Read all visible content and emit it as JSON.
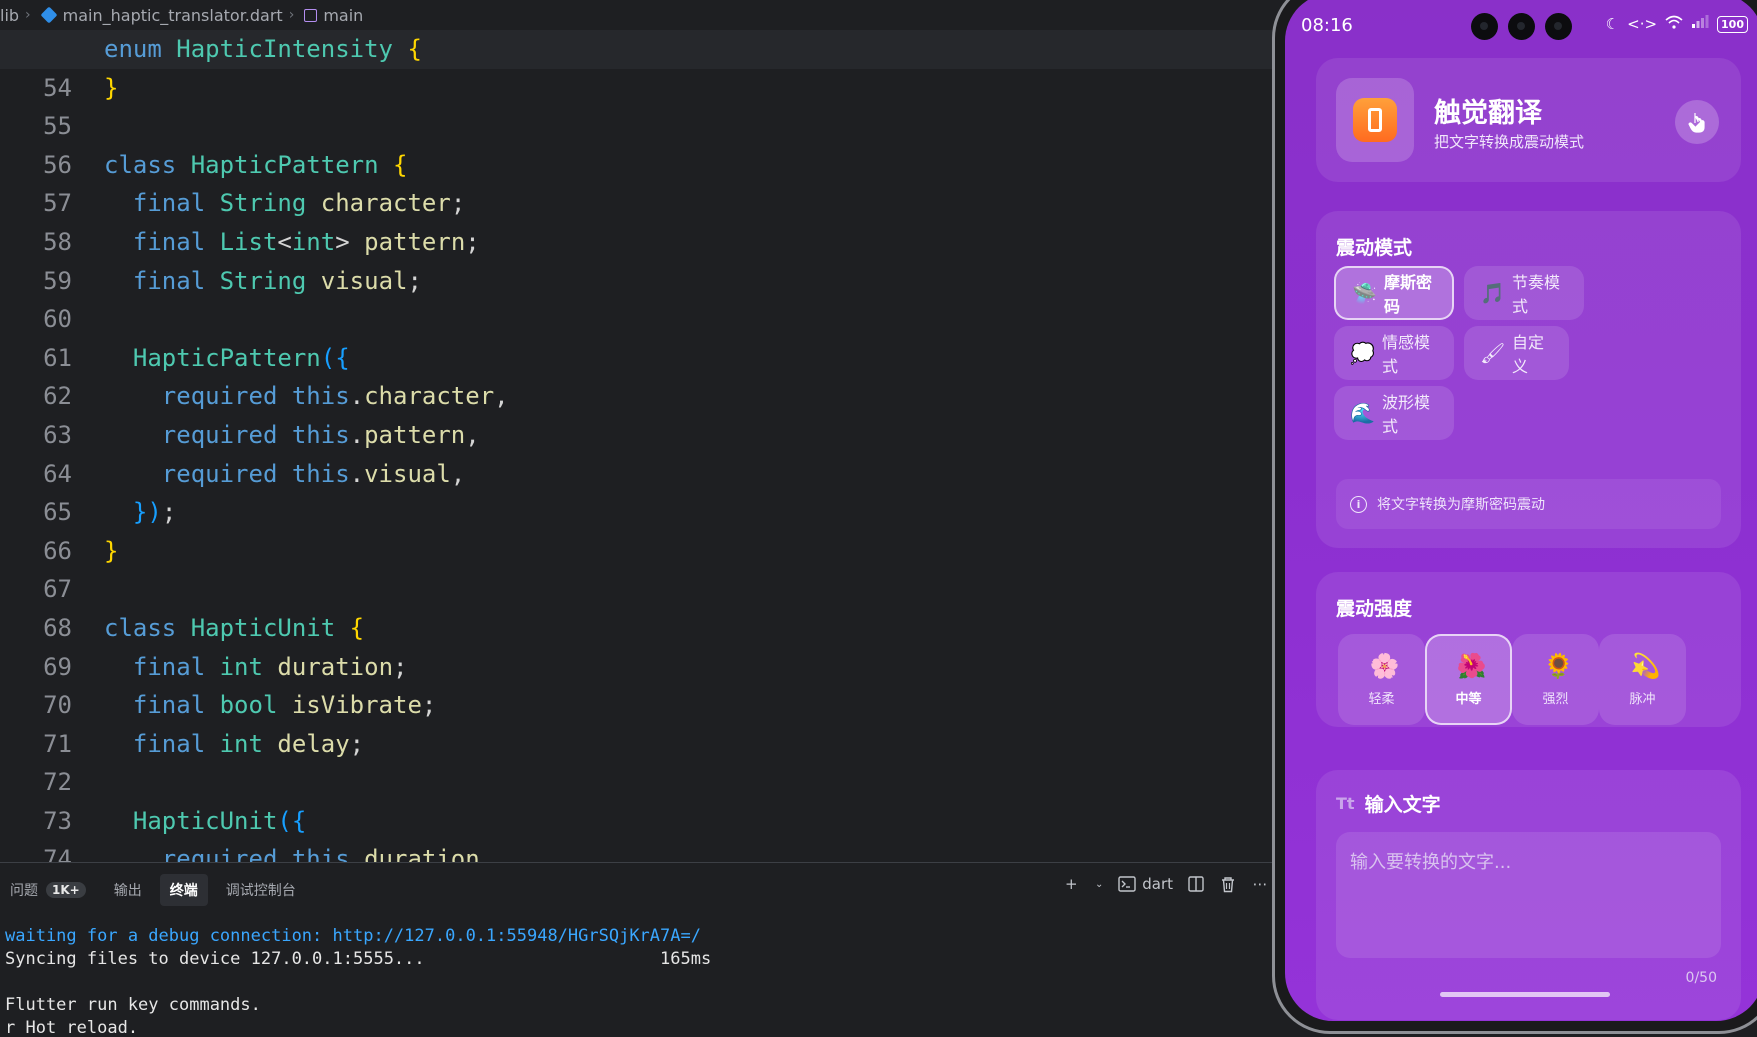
{
  "breadcrumb": {
    "root": "lib",
    "file": "main_haptic_translator.dart",
    "symbol": "main"
  },
  "panel": {
    "tabs": [
      {
        "label": "问题",
        "badge": "1K+"
      },
      {
        "label": "输出"
      },
      {
        "label": "终端"
      },
      {
        "label": "调试控制台"
      }
    ],
    "shell_label": "dart",
    "terminal_lines": [
      "waiting for a debug connection: http://127.0.0.1:55948/HGrSQjKrA7A=/",
      "Syncing files to device 127.0.0.1:5555...                       165ms",
      "",
      "Flutter run key commands.",
      "r Hot reload."
    ]
  },
  "phone": {
    "status": {
      "time": "08:16",
      "battery": "100"
    },
    "app": {
      "title": "触觉翻译",
      "subtitle": "把文字转换成震动模式"
    },
    "mode": {
      "title": "震动模式",
      "options": [
        {
          "label": "摩斯密码",
          "icon": "🛸",
          "icon_name": "ufo-icon"
        },
        {
          "label": "节奏模式",
          "icon": "🎵",
          "icon_name": "music-note-icon"
        },
        {
          "label": "情感模式",
          "icon": "💭",
          "icon_name": "thought-bubble-icon"
        },
        {
          "label": "自定义",
          "icon": "🖌",
          "icon_name": "paintbrush-icon"
        },
        {
          "label": "波形模式",
          "icon": "🌊",
          "icon_name": "wave-icon"
        }
      ],
      "selected": "摩斯密码",
      "info": "将文字转换为摩斯密码震动"
    },
    "intensity": {
      "title": "震动强度",
      "options": [
        {
          "label": "轻柔",
          "icon": "🌸",
          "icon_name": "cherry-blossom-icon"
        },
        {
          "label": "中等",
          "icon": "🌺",
          "icon_name": "hibiscus-icon"
        },
        {
          "label": "强烈",
          "icon": "🌻",
          "icon_name": "sunflower-icon"
        },
        {
          "label": "脉冲",
          "icon": "💫",
          "icon_name": "dizzy-star-icon"
        }
      ],
      "selected": "中等"
    },
    "input": {
      "title": "输入文字",
      "tt_icon": "Tt",
      "placeholder": "输入要转换的文字...",
      "counter": "0/50"
    }
  },
  "colors": {
    "accent": "#8a30c9",
    "editor_bg": "#1e1f22",
    "terminal_url": "#3aa7ff"
  }
}
